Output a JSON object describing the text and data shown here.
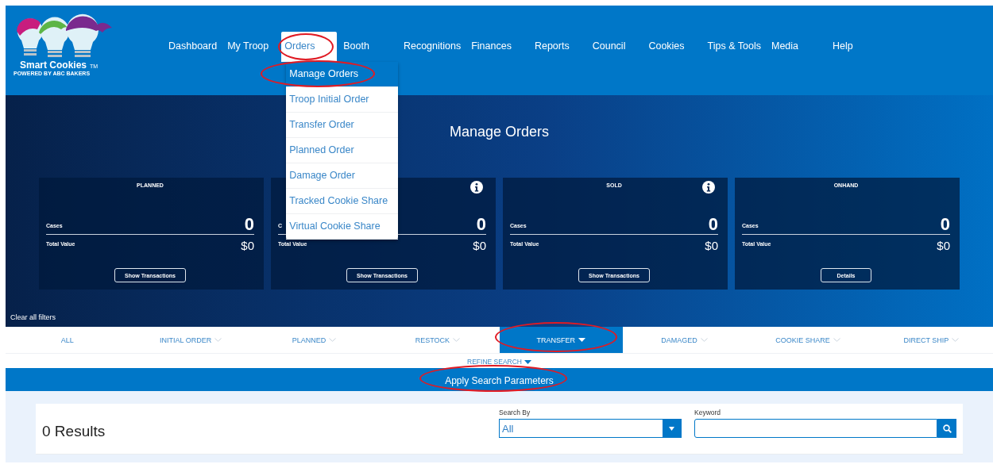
{
  "logo": {
    "name": "Smart Cookies",
    "trademark": "TM",
    "tagline": "POWERED BY ABC BAKERS"
  },
  "nav": [
    {
      "label": "Dashboard",
      "selected": false,
      "highlighted": false
    },
    {
      "label": "My Troop",
      "selected": false,
      "highlighted": false
    },
    {
      "label": "Orders",
      "selected": true,
      "highlighted": true
    },
    {
      "label": "Booth",
      "selected": false,
      "highlighted": false
    },
    {
      "label": "Recognitions",
      "selected": false,
      "highlighted": false
    },
    {
      "label": "Finances",
      "selected": false,
      "highlighted": false
    },
    {
      "label": "Reports",
      "selected": false,
      "highlighted": false
    },
    {
      "label": "Council",
      "selected": false,
      "highlighted": false
    },
    {
      "label": "Cookies",
      "selected": false,
      "highlighted": false
    },
    {
      "label": "Tips & Tools",
      "selected": false,
      "highlighted": false
    },
    {
      "label": "Media",
      "selected": false,
      "highlighted": false
    },
    {
      "label": "Help",
      "selected": false,
      "highlighted": false
    }
  ],
  "orders_menu": [
    {
      "label": "Manage Orders",
      "selected": true,
      "highlighted": true
    },
    {
      "label": "Troop Initial Order",
      "selected": false,
      "highlighted": false
    },
    {
      "label": "Transfer Order",
      "selected": false,
      "highlighted": false
    },
    {
      "label": "Planned Order",
      "selected": false,
      "highlighted": false
    },
    {
      "label": "Damage Order",
      "selected": false,
      "highlighted": false
    },
    {
      "label": "Tracked Cookie Share",
      "selected": false,
      "highlighted": false
    },
    {
      "label": "Virtual Cookie Share",
      "selected": false,
      "highlighted": false
    }
  ],
  "page_title": "Manage Orders",
  "cards": [
    {
      "title": "PLANNED",
      "info": false,
      "cases_label": "Cases",
      "cases": "0",
      "value_label": "Total Value",
      "value": "$0",
      "button": "Show Transactions"
    },
    {
      "info": true,
      "cases_label": "C",
      "cases": "0",
      "value_label": "Total Value",
      "value": "$0",
      "button": "Show Transactions"
    },
    {
      "title": "SOLD",
      "info": true,
      "cases_label": "Cases",
      "cases": "0",
      "value_label": "Total Value",
      "value": "$0",
      "button": "Show Transactions"
    },
    {
      "title": "ONHAND",
      "info": false,
      "cases_label": "Cases",
      "cases": "0",
      "value_label": "Total Value",
      "value": "$0",
      "button": "Details"
    }
  ],
  "clear_filters": "Clear all filters",
  "tabs": [
    {
      "label": "ALL",
      "selected": false,
      "chevron": false,
      "highlighted": false
    },
    {
      "label": "INITIAL ORDER",
      "selected": false,
      "chevron": true,
      "highlighted": false
    },
    {
      "label": "PLANNED",
      "selected": false,
      "chevron": true,
      "highlighted": false
    },
    {
      "label": "RESTOCK",
      "selected": false,
      "chevron": true,
      "highlighted": false
    },
    {
      "label": "TRANSFER",
      "selected": true,
      "chevron": true,
      "highlighted": true
    },
    {
      "label": "DAMAGED",
      "selected": false,
      "chevron": true,
      "highlighted": false
    },
    {
      "label": "COOKIE SHARE",
      "selected": false,
      "chevron": true,
      "highlighted": false
    },
    {
      "label": "DIRECT SHIP",
      "selected": false,
      "chevron": true,
      "highlighted": false
    }
  ],
  "refine_search": "REFINE SEARCH",
  "apply_button": {
    "label": "Apply Search Parameters",
    "highlighted": true
  },
  "results": {
    "count": "0 Results",
    "search_by": {
      "label": "Search By",
      "value": "All"
    },
    "keyword": {
      "label": "Keyword"
    }
  }
}
